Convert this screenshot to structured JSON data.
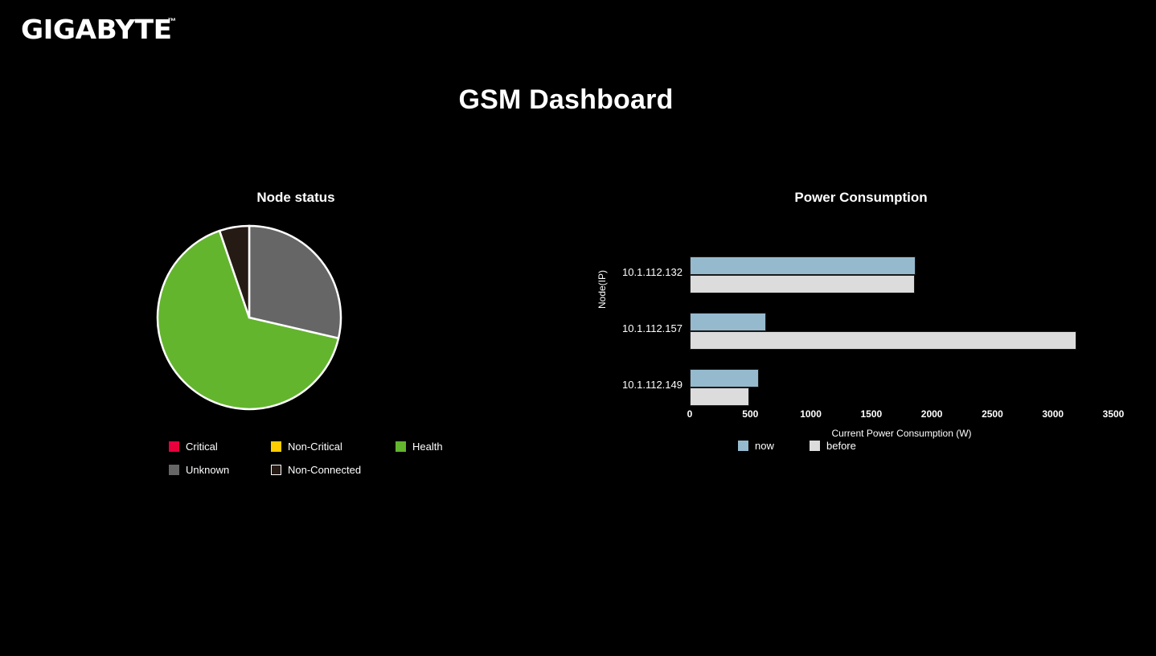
{
  "brand": {
    "name": "GIGABYTE",
    "trademark": "™"
  },
  "header": {
    "title": "GSM Dashboard"
  },
  "node_status": {
    "title": "Node status",
    "legend": [
      {
        "label": "Critical",
        "color": "#E8003C"
      },
      {
        "label": "Non-Critical",
        "color": "#FFCC00"
      },
      {
        "label": "Health",
        "color": "#63B52E"
      },
      {
        "label": "Unknown",
        "color": "#666666"
      },
      {
        "label": "Non-Connected",
        "color": "#261A15"
      }
    ]
  },
  "power": {
    "title": "Power Consumption",
    "ylabel": "Node(IP)",
    "xlabel": "Current Power Consumption (W)",
    "legend": [
      {
        "label": "now",
        "color": "#95BACE"
      },
      {
        "label": "before",
        "color": "#DCDCDC"
      }
    ]
  },
  "chart_data": [
    {
      "type": "pie",
      "title": "Node status",
      "categories": [
        "Critical",
        "Non-Critical",
        "Health",
        "Unknown",
        "Non-Connected"
      ],
      "values": [
        0,
        0,
        66,
        28,
        6
      ],
      "unit": "percent",
      "colors": [
        "#E8003C",
        "#FFCC00",
        "#63B52E",
        "#666666",
        "#261A15"
      ],
      "start_angle": 0,
      "slice_border": "#ffffff",
      "legend_position": "bottom"
    },
    {
      "type": "bar",
      "orientation": "horizontal",
      "title": "Power Consumption",
      "xlabel": "Current Power Consumption (W)",
      "ylabel": "Node(IP)",
      "categories": [
        "10.1.112.132",
        "10.1.112.157",
        "10.1.112.149"
      ],
      "series": [
        {
          "name": "now",
          "color": "#95BACE",
          "values": [
            1865,
            630,
            570
          ]
        },
        {
          "name": "before",
          "color": "#DCDCDC",
          "values": [
            1860,
            3195,
            490
          ]
        }
      ],
      "xlim": [
        0,
        3500
      ],
      "xticks": [
        0,
        500,
        1000,
        1500,
        2000,
        2500,
        3000,
        3500
      ],
      "grid": false,
      "legend_position": "bottom"
    }
  ]
}
